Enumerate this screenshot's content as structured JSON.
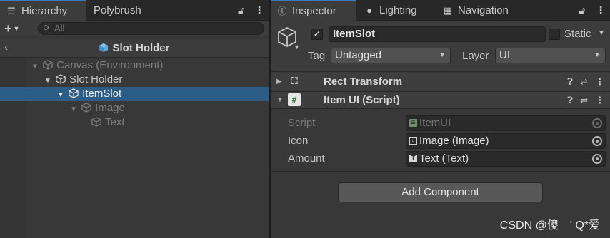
{
  "hierarchy": {
    "tabs": [
      {
        "label": "Hierarchy",
        "icon": "hierarchy-list-icon"
      },
      {
        "label": "Polybrush"
      }
    ],
    "toolbar": {
      "add_label": "+",
      "search_placeholder": "All"
    },
    "breadcrumb": {
      "title": "Slot Holder",
      "icon": "prefab-cube-icon"
    },
    "rows": [
      {
        "label": "Canvas (Environment)",
        "depth": 0,
        "expanded": true,
        "dim": true
      },
      {
        "label": "Slot Holder",
        "depth": 1,
        "expanded": true,
        "dim": false
      },
      {
        "label": "ItemSlot",
        "depth": 2,
        "expanded": true,
        "dim": false,
        "selected": true
      },
      {
        "label": "Image",
        "depth": 3,
        "expanded": true,
        "dim": true
      },
      {
        "label": "Text",
        "depth": 4,
        "expanded": false,
        "dim": true
      }
    ]
  },
  "inspector": {
    "tabs": [
      {
        "label": "Inspector",
        "icon": "info-icon"
      },
      {
        "label": "Lighting",
        "icon": "lightbulb-icon"
      },
      {
        "label": "Navigation",
        "icon": "navigation-icon"
      }
    ],
    "object": {
      "name": "ItemSlot",
      "active_check": "✓",
      "static_label": "Static",
      "tag_label": "Tag",
      "tag_value": "Untagged",
      "layer_label": "Layer",
      "layer_value": "UI"
    },
    "components": [
      {
        "name": "Rect Transform",
        "icon": "rect-transform-icon"
      },
      {
        "name": "Item UI (Script)",
        "icon": "csharp-script-icon"
      }
    ],
    "properties": [
      {
        "label": "Script",
        "value": "ItemUI",
        "icon": "script-file-icon",
        "disabled": true
      },
      {
        "label": "Icon",
        "value": "Image (Image)",
        "icon": "image-component-icon",
        "disabled": false
      },
      {
        "label": "Amount",
        "value": "Text (Text)",
        "icon": "text-component-icon",
        "disabled": false
      }
    ],
    "add_component_label": "Add Component"
  },
  "watermark": "CSDN @傻　' Q*爱",
  "colors": {
    "selection": "#2c5d87",
    "tab_accent": "#3a79bb",
    "panel_bg": "#383838"
  }
}
